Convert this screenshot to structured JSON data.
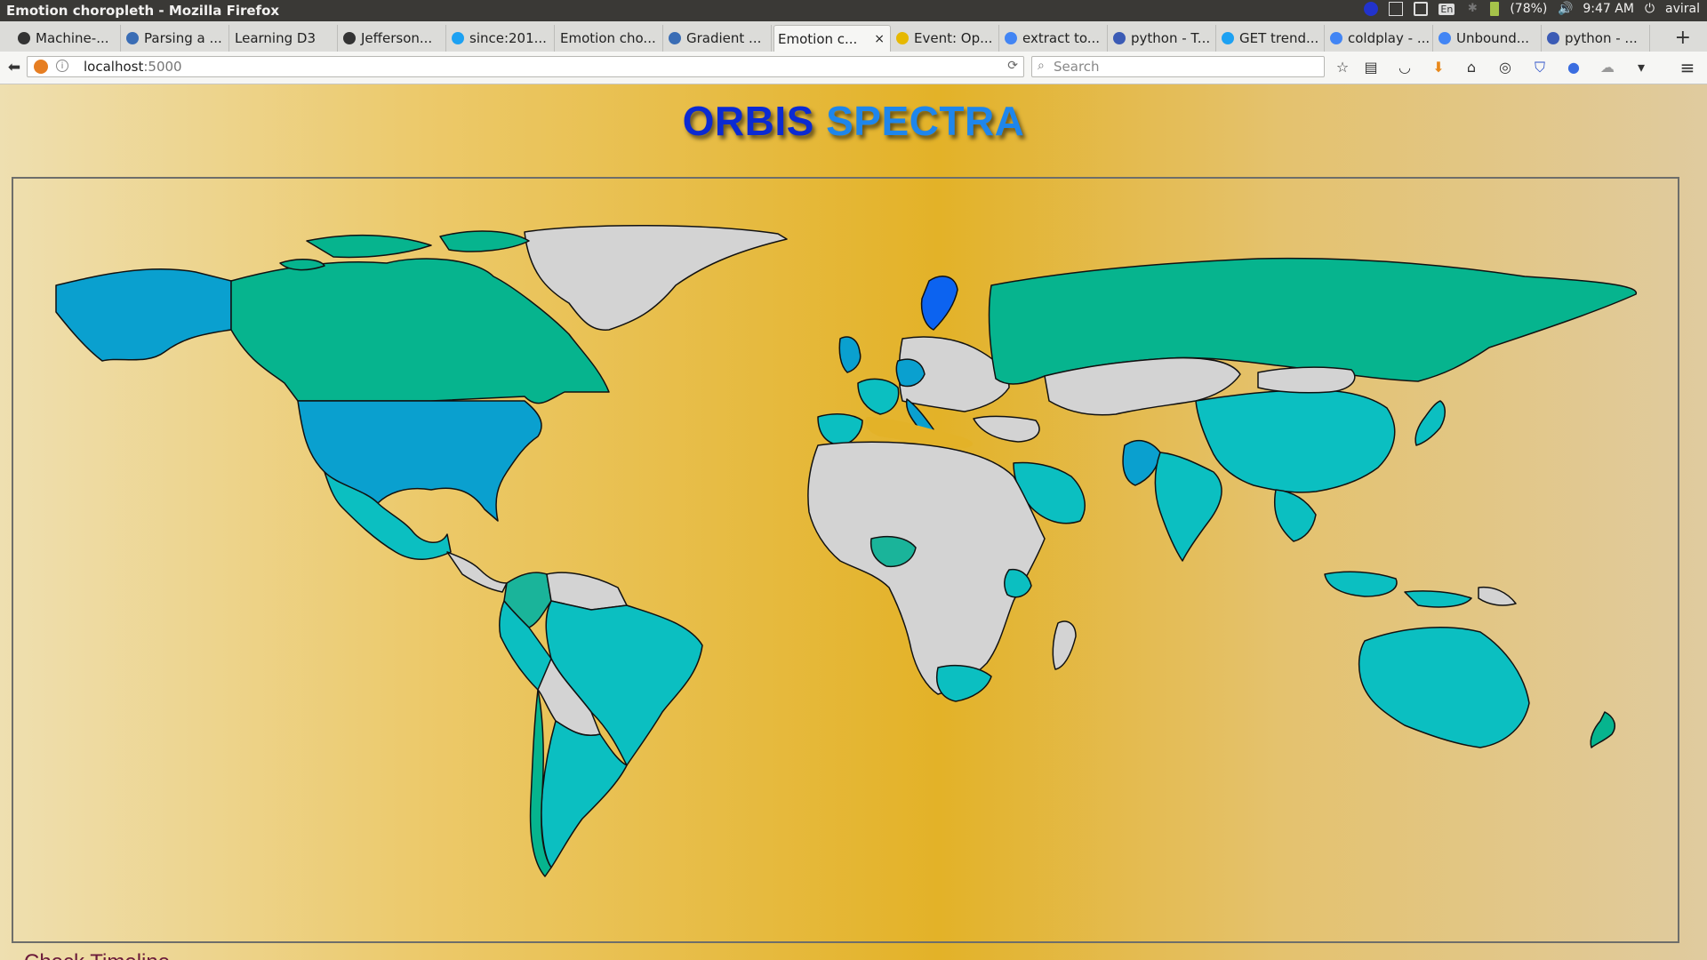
{
  "window": {
    "title": "Emotion choropleth - Mozilla Firefox"
  },
  "tray": {
    "battery": "(78%)",
    "time": "9:47 AM",
    "user": "aviral",
    "keyboard": "En"
  },
  "tabs": [
    {
      "label": "Machine-...",
      "icon": "github-icon"
    },
    {
      "label": "Parsing a ...",
      "icon": "site-icon"
    },
    {
      "label": "Learning D3",
      "icon": ""
    },
    {
      "label": "Jefferson...",
      "icon": "github-icon"
    },
    {
      "label": "since:201...",
      "icon": "twitter-icon"
    },
    {
      "label": "Emotion cho...",
      "icon": ""
    },
    {
      "label": "Gradient ...",
      "icon": "site-icon"
    },
    {
      "label": "Emotion c...",
      "icon": "",
      "active": true
    },
    {
      "label": "Event: Op...",
      "icon": "moon-icon"
    },
    {
      "label": "extract to...",
      "icon": "google-icon"
    },
    {
      "label": "python - T...",
      "icon": "stackoverflow-icon"
    },
    {
      "label": "GET trend...",
      "icon": "twitter-icon"
    },
    {
      "label": "coldplay - ...",
      "icon": "google-icon"
    },
    {
      "label": "Unbound...",
      "icon": "google-icon"
    },
    {
      "label": "python - ...",
      "icon": "stackoverflow-icon"
    }
  ],
  "urlbar": {
    "host": "localhost",
    "port": ":5000"
  },
  "search": {
    "placeholder": "Search"
  },
  "page": {
    "title_word1": "ORBIS",
    "title_word2": "SPECTRA",
    "link": "Check Timeline"
  },
  "colors": {
    "no_data": "#d3d3d3",
    "teal_green": "#06b48e",
    "cyan": "#0bbfc1",
    "blue": "#0aa0cf",
    "deep_blue": "#0c63f0",
    "mediterranean": "#e3b228",
    "border": "#111111"
  }
}
